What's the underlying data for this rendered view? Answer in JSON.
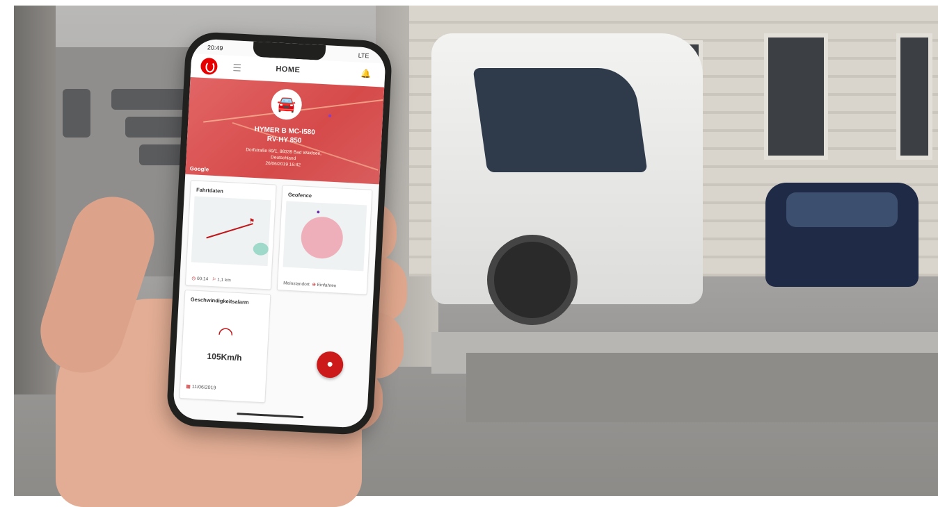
{
  "status": {
    "time": "20:49",
    "network": "LTE"
  },
  "app": {
    "title": "HOME",
    "menu_icon": "hamburger-icon",
    "bell_icon": "bell-icon",
    "logo": "vodafone-logo"
  },
  "vehicle": {
    "name_line1": "HYMER B MC-I580",
    "name_line2": "RV-HY 850",
    "address_line1": "Dorfstraße 69/1, 88339 Bad Waldsee,",
    "address_line2": "Deutschland",
    "address_line3": "26/06/2019 16:42",
    "map_attribution": "Google"
  },
  "cards": {
    "fahrtdaten": {
      "title": "Fahrtdaten",
      "duration": "00:14",
      "distance": "1,1 km"
    },
    "geofence": {
      "title": "Geofence",
      "label": "Meinstandort",
      "action": "Einfahren"
    },
    "speed_alarm": {
      "title": "Geschwindigkeitsalarm",
      "speed": "105Km/h",
      "date": "11/06/2019"
    }
  },
  "colors": {
    "brand": "#e60000",
    "accent": "#c0161a",
    "hero": "#d95d5d"
  }
}
